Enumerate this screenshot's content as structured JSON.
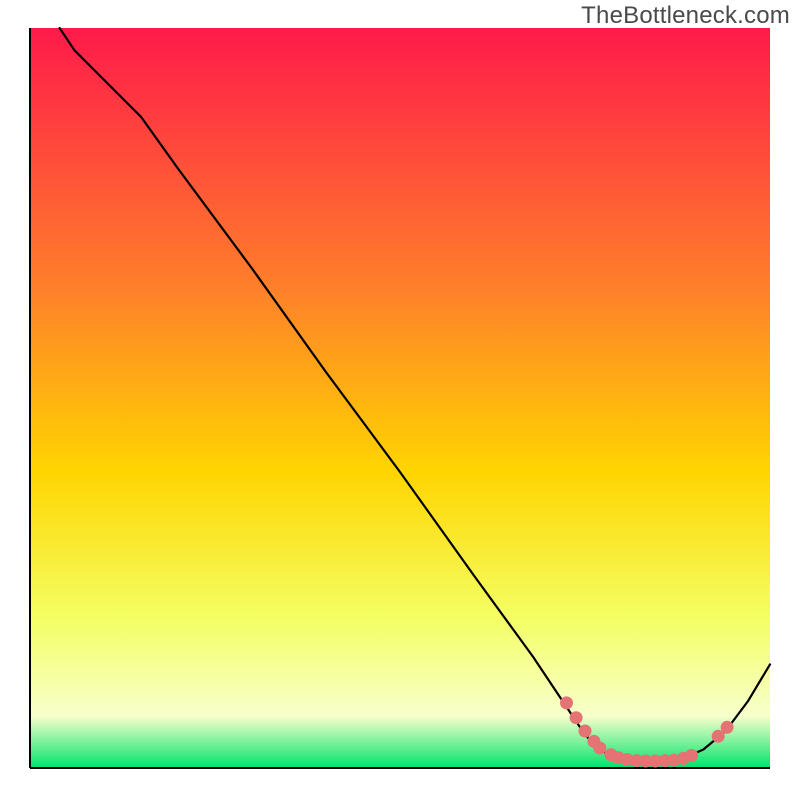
{
  "watermark": "TheBottleneck.com",
  "colors": {
    "grad_top": "#ff1a4a",
    "grad_upper_mid": "#ff7f2a",
    "grad_mid": "#ffd500",
    "grad_lower_mid": "#f4ff66",
    "grad_pale": "#f7ffcc",
    "grad_bottom": "#00e36b",
    "axis": "#000000",
    "curve": "#000000",
    "points": "#e57373"
  },
  "chart_data": {
    "type": "line",
    "title": "",
    "xlabel": "",
    "ylabel": "",
    "xlim": [
      0,
      100
    ],
    "ylim": [
      0,
      100
    ],
    "curve": [
      {
        "x": 4,
        "y": 100
      },
      {
        "x": 6,
        "y": 97
      },
      {
        "x": 10,
        "y": 93
      },
      {
        "x": 15,
        "y": 88
      },
      {
        "x": 20,
        "y": 81
      },
      {
        "x": 30,
        "y": 67.5
      },
      {
        "x": 40,
        "y": 53.5
      },
      {
        "x": 50,
        "y": 40
      },
      {
        "x": 60,
        "y": 26
      },
      {
        "x": 68,
        "y": 15
      },
      {
        "x": 72,
        "y": 9
      },
      {
        "x": 75,
        "y": 4.5
      },
      {
        "x": 77,
        "y": 2.5
      },
      {
        "x": 79,
        "y": 1.4
      },
      {
        "x": 82,
        "y": 1.0
      },
      {
        "x": 85,
        "y": 1.0
      },
      {
        "x": 88,
        "y": 1.2
      },
      {
        "x": 91,
        "y": 2.5
      },
      {
        "x": 94,
        "y": 5
      },
      {
        "x": 97,
        "y": 9
      },
      {
        "x": 100,
        "y": 14
      }
    ],
    "points": [
      {
        "x": 72.5,
        "y": 8.8
      },
      {
        "x": 73.8,
        "y": 6.8
      },
      {
        "x": 75.0,
        "y": 5.0
      },
      {
        "x": 76.2,
        "y": 3.6
      },
      {
        "x": 77.0,
        "y": 2.7
      },
      {
        "x": 78.5,
        "y": 1.8
      },
      {
        "x": 79.5,
        "y": 1.4
      },
      {
        "x": 80.7,
        "y": 1.15
      },
      {
        "x": 82.0,
        "y": 1.0
      },
      {
        "x": 83.2,
        "y": 0.95
      },
      {
        "x": 84.5,
        "y": 0.95
      },
      {
        "x": 85.8,
        "y": 1.0
      },
      {
        "x": 87.0,
        "y": 1.05
      },
      {
        "x": 88.3,
        "y": 1.3
      },
      {
        "x": 89.4,
        "y": 1.7
      },
      {
        "x": 93.0,
        "y": 4.3
      },
      {
        "x": 94.2,
        "y": 5.5
      }
    ],
    "annotations": []
  }
}
